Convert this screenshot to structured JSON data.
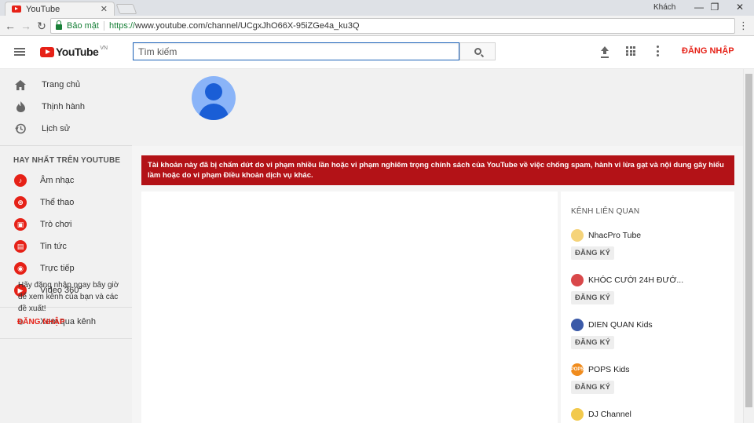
{
  "browser": {
    "tab_title": "YouTube",
    "tab_close": "✕",
    "user_label": "Khách",
    "win_minimize": "—",
    "win_restore": "❐",
    "win_close": "✕",
    "secure_label": "Bảo mật",
    "url_scheme": "https://",
    "url_rest": "www.youtube.com/channel/UCgxJhO66X-95iZGe4a_ku3Q",
    "back": "←",
    "forward": "→",
    "reload": "↻",
    "menu": "⋮"
  },
  "header": {
    "logo_text": "YouTube",
    "logo_region": "VN",
    "search_placeholder": "Tìm kiếm",
    "signin": "ĐĂNG NHẬP"
  },
  "sidebar": {
    "main_items": [
      {
        "label": "Trang chủ",
        "icon": "home-icon"
      },
      {
        "label": "Thịnh hành",
        "icon": "trending-flame-icon"
      },
      {
        "label": "Lịch sử",
        "icon": "history-icon"
      }
    ],
    "best_heading": "HAY NHẤT TRÊN YOUTUBE",
    "best_items": [
      {
        "label": "Âm nhạc",
        "icon": "music-icon"
      },
      {
        "label": "Thể thao",
        "icon": "sports-icon"
      },
      {
        "label": "Trò chơi",
        "icon": "gaming-icon"
      },
      {
        "label": "Tin tức",
        "icon": "news-icon"
      },
      {
        "label": "Trực tiếp",
        "icon": "live-icon"
      },
      {
        "label": "Video 360°",
        "icon": "video-360-icon"
      }
    ],
    "browse_channels": "Xem qua kênh",
    "signin_prompt": "Hãy đăng nhập ngay bây giờ để xem kênh của bạn và các đề xuất!",
    "signin_link": "ĐĂNG NHẬP"
  },
  "main": {
    "alert_text": "Tài khoản này đã bị chấm dứt do vi phạm nhiều lần hoặc vi phạm nghiêm trọng chính sách của YouTube về việc chống spam, hành vi lừa gạt và nội dung gây hiểu lầm hoặc do vi phạm Điều khoản dịch vụ khác."
  },
  "related": {
    "title": "KÊNH LIÊN QUAN",
    "subscribe_label": "ĐĂNG KÝ",
    "channels": [
      {
        "name": "NhacPro Tube",
        "thumb_color": "#f5d37a"
      },
      {
        "name": "KHÓC CƯỜI 24H ĐƯỚ...",
        "thumb_color": "#d9484a"
      },
      {
        "name": "DIEN QUAN Kids",
        "thumb_color": "#3b5aa8"
      },
      {
        "name": "POPS Kids",
        "thumb_color": "#f08c1e",
        "thumb_text": "POPS"
      },
      {
        "name": "DJ Channel",
        "thumb_color": "#f2c94c"
      }
    ]
  },
  "colors": {
    "brand_red": "#e62117",
    "alert_red": "#b31217",
    "link_blue": "#1c62b9",
    "secure_green": "#188038"
  }
}
